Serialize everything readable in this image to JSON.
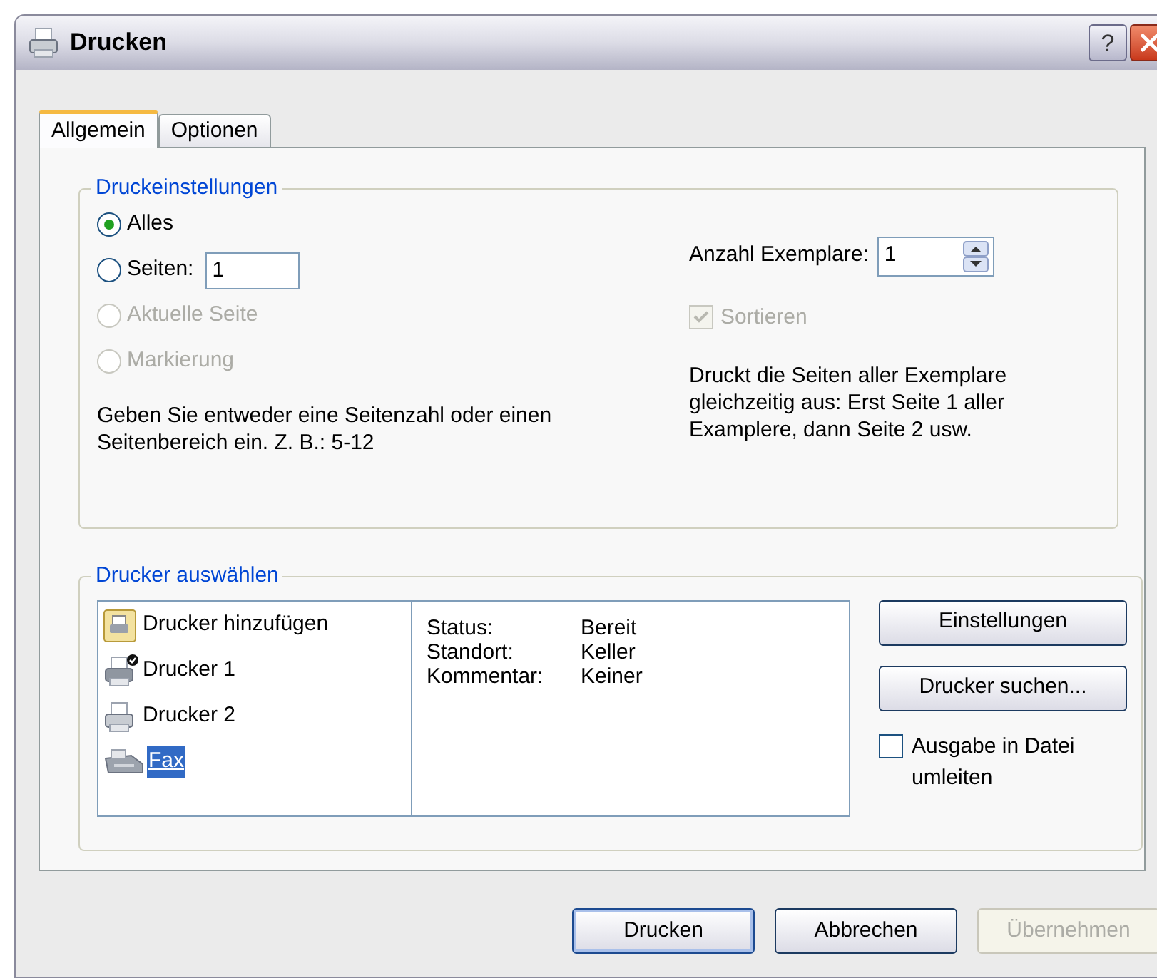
{
  "window": {
    "title": "Drucken",
    "help": "?"
  },
  "tabs": [
    {
      "label": "Allgemein",
      "selected": true
    },
    {
      "label": "Optionen",
      "selected": false
    }
  ],
  "print_settings": {
    "title": "Druckeinstellungen",
    "ranges": [
      {
        "label": "Alles",
        "selected": true,
        "disabled": false
      },
      {
        "label": "Seiten:",
        "selected": false,
        "disabled": false,
        "value": "1"
      },
      {
        "label": "Aktuelle Seite",
        "selected": false,
        "disabled": true
      },
      {
        "label": "Markierung",
        "selected": false,
        "disabled": true
      }
    ],
    "hint": "Geben Sie entweder eine Seitenzahl oder einen Seitenbereich ein. Z. B.: 5-12",
    "copies": {
      "label": "Anzahl Exemplare:",
      "value": "1"
    },
    "collate": {
      "label": "Sortieren",
      "checked": true,
      "disabled": true
    },
    "collate_hint": "Druckt die Seiten aller Exemplare gleichzeitig aus: Erst Seite 1 aller Examplere, dann Seite 2 usw."
  },
  "printer_select": {
    "title": "Drucker auswählen",
    "printers": [
      {
        "name": "Drucker hinzufügen",
        "kind": "add",
        "default": false,
        "selected": false
      },
      {
        "name": "Drucker 1",
        "kind": "printer",
        "default": true,
        "selected": false
      },
      {
        "name": "Drucker 2",
        "kind": "printer",
        "default": false,
        "selected": false
      },
      {
        "name": "Fax",
        "kind": "fax",
        "default": false,
        "selected": true
      }
    ],
    "details": [
      {
        "label": "Status:",
        "value": "Bereit"
      },
      {
        "label": "Standort:",
        "value": "Keller"
      },
      {
        "label": "Kommentar:",
        "value": "Keiner"
      }
    ],
    "buttons": [
      {
        "label": "Einstellungen",
        "disabled": false
      },
      {
        "label": "Drucker suchen...",
        "disabled": false
      }
    ],
    "to_file": {
      "label": "Ausgabe in Datei umleiten",
      "checked": false
    }
  },
  "buttons": [
    {
      "label": "Drucken",
      "disabled": false,
      "default": true
    },
    {
      "label": "Abbrechen",
      "disabled": false,
      "default": false
    },
    {
      "label": "Übernehmen",
      "disabled": true,
      "default": false
    }
  ]
}
